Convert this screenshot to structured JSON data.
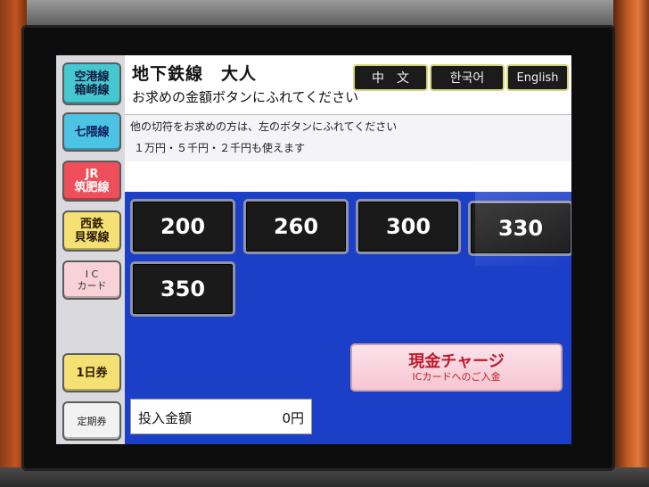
{
  "sidebar": {
    "items": [
      {
        "lines": [
          "空港線",
          "箱崎線"
        ],
        "color": "#45c8cf",
        "text_color": "#101a40"
      },
      {
        "lines": [
          "七隈線"
        ],
        "color": "#4cc3e2",
        "text_color": "#0c1a5a"
      },
      {
        "lines": [
          "JR",
          "筑肥線"
        ],
        "color": "#ef4f5a",
        "text_color": "#ffffff"
      },
      {
        "lines": [
          "西鉄",
          "貝塚線"
        ],
        "color": "#f5e173",
        "text_color": "#2a1a00"
      },
      {
        "lines": [
          "I C",
          "カード"
        ],
        "color": "#f9d2d8",
        "text_color": "#333333"
      },
      {
        "lines": [
          "1日券"
        ],
        "color": "#f5e173",
        "text_color": "#2a1a00"
      },
      {
        "lines": [
          "定期券"
        ],
        "color": "#f2f2f2",
        "text_color": "#222222"
      }
    ]
  },
  "header": {
    "title": "地下鉄線　大人",
    "subtitle": "お求めの金額ボタンにふれてください",
    "languages": [
      "中　文",
      "한국어",
      "English"
    ]
  },
  "info": {
    "line1": "他の切符をお求めの方は、左のボタンにふれてください",
    "line2": "１万円・５千円・２千円も使えます"
  },
  "fares": [
    "200",
    "260",
    "300",
    "330",
    "350"
  ],
  "charge": {
    "main": "現金チャージ",
    "sub": "ICカードへのご入金"
  },
  "deposit": {
    "label": "投入金額",
    "value": "0円"
  },
  "colors": {
    "main_panel": "#1c3fc8",
    "fare_button": "#1a1a1a",
    "charge_text": "#c0182d"
  }
}
